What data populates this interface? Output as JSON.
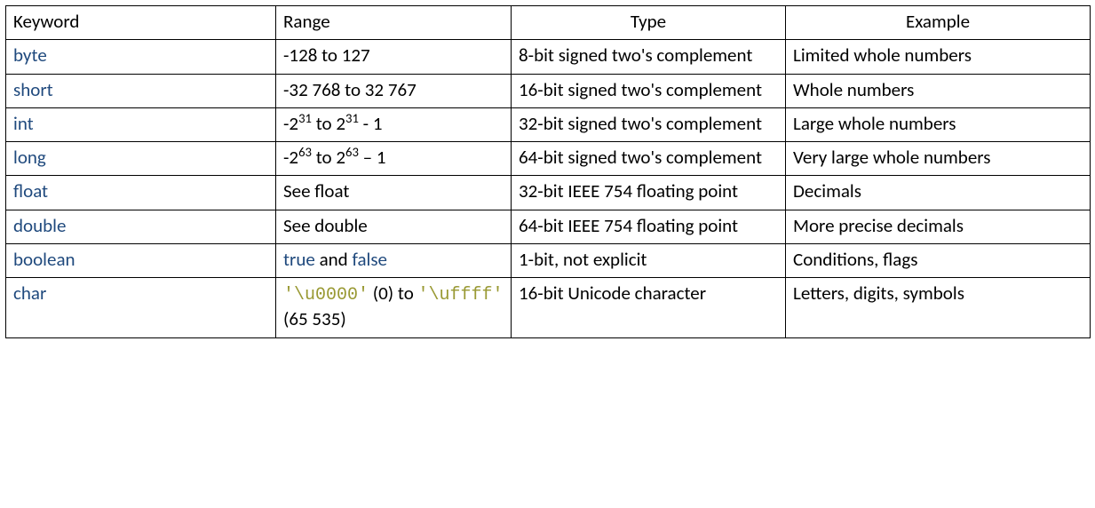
{
  "headers": {
    "keyword": "Keyword",
    "range": "Range",
    "type": "Type",
    "example": "Example"
  },
  "rows": {
    "byte": {
      "keyword": "byte",
      "range": "-128 to 127",
      "type": "8-bit signed two's complement",
      "example": "Limited whole numbers"
    },
    "short": {
      "keyword": "short",
      "range": "-32 768 to 32 767",
      "type": "16-bit signed two's complement",
      "example": "Whole numbers"
    },
    "int": {
      "keyword": "int",
      "range_prefix": "-2",
      "range_exp1": "31",
      "range_mid": " to 2",
      "range_exp2": "31",
      "range_suffix": " - 1",
      "type": "32-bit signed two's complement",
      "example": "Large whole numbers"
    },
    "long": {
      "keyword": "long",
      "range_prefix": "-2",
      "range_exp1": "63",
      "range_mid": " to 2",
      "range_exp2": "63",
      "range_suffix": " – 1",
      "type": "64-bit signed two's complement",
      "example": "Very large whole numbers"
    },
    "float": {
      "keyword": "float",
      "range": "See float",
      "type": "32-bit IEEE 754 floating point",
      "example": "Decimals"
    },
    "double": {
      "keyword": "double",
      "range": "See double",
      "type": "64-bit IEEE 754 floating point",
      "example": "More precise decimals"
    },
    "boolean": {
      "keyword": "boolean",
      "range_true": "true",
      "range_and": " and ",
      "range_false": "false",
      "type": "1-bit, not explicit",
      "example": "Conditions, flags"
    },
    "char": {
      "keyword": "char",
      "range_code1": "'\\u0000'",
      "range_mid1": " (0) to ",
      "range_code2": "'\\uffff'",
      "range_mid2": " (65 535)",
      "type": "16-bit Unicode character",
      "example": "Letters, digits, symbols"
    }
  }
}
